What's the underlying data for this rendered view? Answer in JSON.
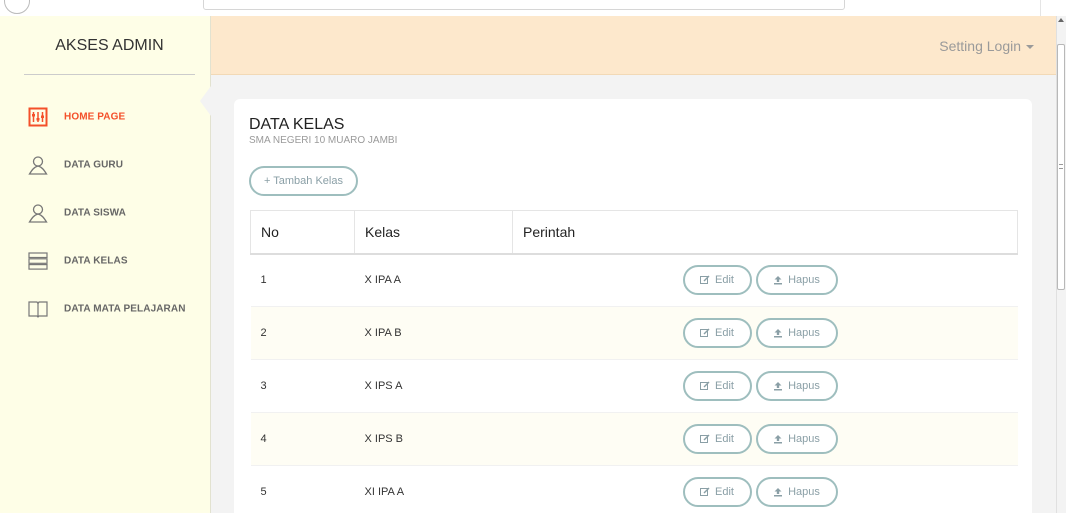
{
  "sidebar": {
    "brand": "AKSES ADMIN",
    "items": [
      {
        "label": "HOME PAGE",
        "icon": "home-icon",
        "active": true
      },
      {
        "label": "DATA GURU",
        "icon": "user-icon",
        "active": false
      },
      {
        "label": "DATA SISWA",
        "icon": "user-icon",
        "active": false
      },
      {
        "label": "DATA KELAS",
        "icon": "server-icon",
        "active": false
      },
      {
        "label": "DATA MATA PELAJARAN",
        "icon": "book-icon",
        "active": false
      }
    ]
  },
  "header": {
    "setting_label": "Setting Login"
  },
  "main": {
    "title": "DATA KELAS",
    "subtitle": "SMA NEGERI 10 MUARO JAMBI",
    "add_button": "+ Tambah Kelas",
    "table": {
      "columns": [
        "No",
        "Kelas",
        "Perintah"
      ],
      "edit_label": "Edit",
      "delete_label": "Hapus",
      "rows": [
        {
          "no": "1",
          "kelas": "X IPA A"
        },
        {
          "no": "2",
          "kelas": "X IPA B"
        },
        {
          "no": "3",
          "kelas": "X IPS A"
        },
        {
          "no": "4",
          "kelas": "X IPS B"
        },
        {
          "no": "5",
          "kelas": "XI IPA A"
        }
      ]
    }
  },
  "colors": {
    "sidebar_bg": "#fefee7",
    "header_bg": "#fde8cc",
    "active_accent": "#f4502a",
    "button_border": "#9ebebe"
  }
}
